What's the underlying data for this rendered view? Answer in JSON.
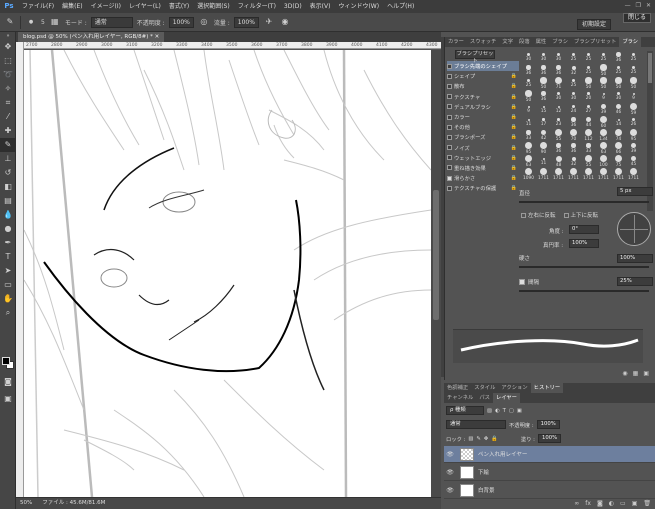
{
  "menubar": {
    "logo": "Ps",
    "items": [
      "ファイル(F)",
      "編集(E)",
      "イメージ(I)",
      "レイヤー(L)",
      "書式(Y)",
      "選択範囲(S)",
      "フィルター(T)",
      "3D(D)",
      "表示(V)",
      "ウィンドウ(W)",
      "ヘルプ(H)"
    ]
  },
  "options": {
    "brush_size": "5",
    "mode_label": "モード :",
    "mode_value": "通常",
    "opacity_label": "不透明度 :",
    "opacity_value": "100%",
    "flow_label": "流量 :",
    "flow_value": "100%",
    "close_label": "閉じる",
    "workspace_label": "初期設定"
  },
  "document": {
    "tab_title": "blog.psd @ 50% (ペン入れ用レイヤー, RGB/8#) *",
    "ruler_ticks": [
      "2700",
      "2800",
      "2900",
      "3000",
      "3100",
      "3200",
      "3300",
      "3400",
      "3500",
      "3600",
      "3700",
      "3800",
      "3900",
      "4000",
      "4100",
      "4200",
      "4300"
    ],
    "zoom": "50%",
    "file_info": "ファイル : 45.6M/81.6M"
  },
  "brush_panel": {
    "tabs": [
      "カラー",
      "スウォッチ",
      "文字",
      "段落",
      "属性",
      "ブラシ",
      "ブラシプリセット",
      "ブラシ"
    ],
    "active_tab_index": 7,
    "preset_button": "ブラシプリセット",
    "options": [
      {
        "label": "ブラシ先端のシェイプ",
        "checked": false,
        "selected": true,
        "lock": false
      },
      {
        "label": "シェイプ",
        "checked": false,
        "selected": false,
        "lock": true
      },
      {
        "label": "散布",
        "checked": false,
        "selected": false,
        "lock": true
      },
      {
        "label": "テクスチャ",
        "checked": false,
        "selected": false,
        "lock": true
      },
      {
        "label": "デュアルブラシ",
        "checked": false,
        "selected": false,
        "lock": true
      },
      {
        "label": "カラー",
        "checked": false,
        "selected": false,
        "lock": true
      },
      {
        "label": "その他",
        "checked": false,
        "selected": false,
        "lock": true
      },
      {
        "label": "ブラシポーズ",
        "checked": false,
        "selected": false,
        "lock": true
      },
      {
        "label": "ノイズ",
        "checked": false,
        "selected": false,
        "lock": true
      },
      {
        "label": "ウェットエッジ",
        "checked": false,
        "selected": false,
        "lock": true
      },
      {
        "label": "重ね描き効果",
        "checked": false,
        "selected": false,
        "lock": true
      },
      {
        "label": "滑らかさ",
        "checked": true,
        "selected": false,
        "lock": true
      },
      {
        "label": "テクスチャの保護",
        "checked": false,
        "selected": false,
        "lock": true
      }
    ],
    "tip_sizes": [
      "30",
      "30",
      "30",
      "25",
      "25",
      "25",
      "36",
      "25",
      "36",
      "36",
      "36",
      "32",
      "25",
      "50",
      "25",
      "25",
      "25",
      "50",
      "71",
      "25",
      "50",
      "50",
      "50",
      "50",
      "50",
      "36",
      "30",
      "30",
      "20",
      "9",
      "30",
      "9",
      "9",
      "15",
      "12",
      "24",
      "27",
      "39",
      "46",
      "59",
      "11",
      "17",
      "23",
      "36",
      "44",
      "60",
      "14",
      "26",
      "33",
      "42",
      "55",
      "70",
      "112",
      "134",
      "74",
      "95",
      "95",
      "90",
      "36",
      "36",
      "33",
      "63",
      "66",
      "39",
      "63",
      "11",
      "48",
      "32",
      "55",
      "100",
      "75",
      "45",
      "1090",
      "1711",
      "1711",
      "1711",
      "1711",
      "1711",
      "1711",
      "1711"
    ],
    "size_label": "直径",
    "size_value": "5 px",
    "flip_x_label": "左右に反転",
    "flip_y_label": "上下に反転",
    "angle_label": "角度 :",
    "angle_value": "0°",
    "roundness_label": "真円率 :",
    "roundness_value": "100%",
    "hardness_label": "硬さ",
    "hardness_value": "100%",
    "spacing_label": "間隔",
    "spacing_checked": true,
    "spacing_value": "25%"
  },
  "history_tabs": [
    "色調補正",
    "スタイル",
    "アクション",
    "ヒストリー"
  ],
  "history_active_index": 3,
  "layer_tabs": [
    "チャンネル",
    "パス",
    "レイヤー"
  ],
  "layer_active_index": 2,
  "layers_panel": {
    "filter_label": "ρ 種類",
    "blend_mode": "通常",
    "opacity_label": "不透明度 :",
    "opacity_value": "100%",
    "lock_label": "ロック :",
    "fill_label": "塗り :",
    "fill_value": "100%",
    "layers": [
      {
        "name": "ペン入れ用レイヤー",
        "active": true,
        "thumb": "checker"
      },
      {
        "name": "下絵",
        "active": false,
        "thumb": "sketch"
      },
      {
        "name": "白背景",
        "active": false,
        "thumb": "white"
      }
    ]
  },
  "colors": {
    "selected_layer": "#6d7f9e",
    "brush_selected": "#6b7d96",
    "canvas": "#ffffff",
    "ui_dark": "#535353"
  }
}
